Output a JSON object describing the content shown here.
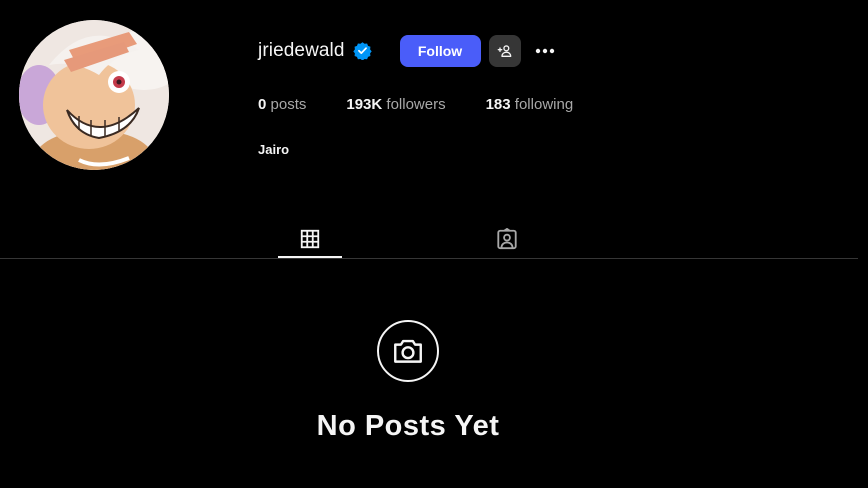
{
  "profile": {
    "username": "jriedewald",
    "verified": true,
    "display_name": "Jairo",
    "avatar_icon": "profile-photo"
  },
  "actions": {
    "follow_label": "Follow",
    "add_friend_icon": "person-plus-icon",
    "more_icon": "more-horizontal-icon"
  },
  "stats": [
    {
      "value": "0",
      "label": "posts"
    },
    {
      "value": "193K",
      "label": "followers"
    },
    {
      "value": "183",
      "label": "following"
    }
  ],
  "tabs": [
    {
      "name": "posts",
      "icon": "grid-icon",
      "active": true
    },
    {
      "name": "tagged",
      "icon": "tagged-icon",
      "active": false
    }
  ],
  "empty_state": {
    "icon": "camera-icon",
    "title": "No Posts Yet"
  },
  "colors": {
    "background": "#000000",
    "primary_button": "#4a5df9",
    "secondary_button": "#363636",
    "verified_badge": "#0095f6",
    "text": "#f5f5f5",
    "muted_text": "#a8a8a8"
  }
}
